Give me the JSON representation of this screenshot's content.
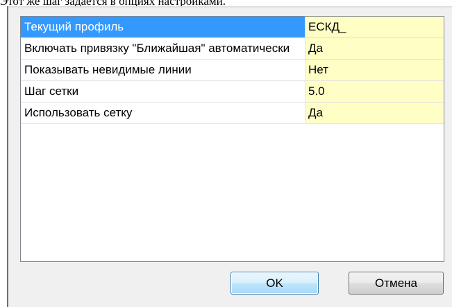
{
  "caption": "Этот же шаг задается в опциях настройками.",
  "properties": [
    {
      "name": "Текущий профиль",
      "value": "ЕСКД_"
    },
    {
      "name": "Включать привязку \"Ближайшая\" автоматически",
      "value": "Да"
    },
    {
      "name": "Показывать невидимые линии",
      "value": "Нет"
    },
    {
      "name": "Шаг сетки",
      "value": "5.0"
    },
    {
      "name": "Использовать сетку",
      "value": "Да"
    }
  ],
  "buttons": {
    "ok_label": "OK",
    "cancel_label": "Отмена"
  },
  "colors": {
    "selection": "#3399ff",
    "value_background": "#ffffc5"
  }
}
